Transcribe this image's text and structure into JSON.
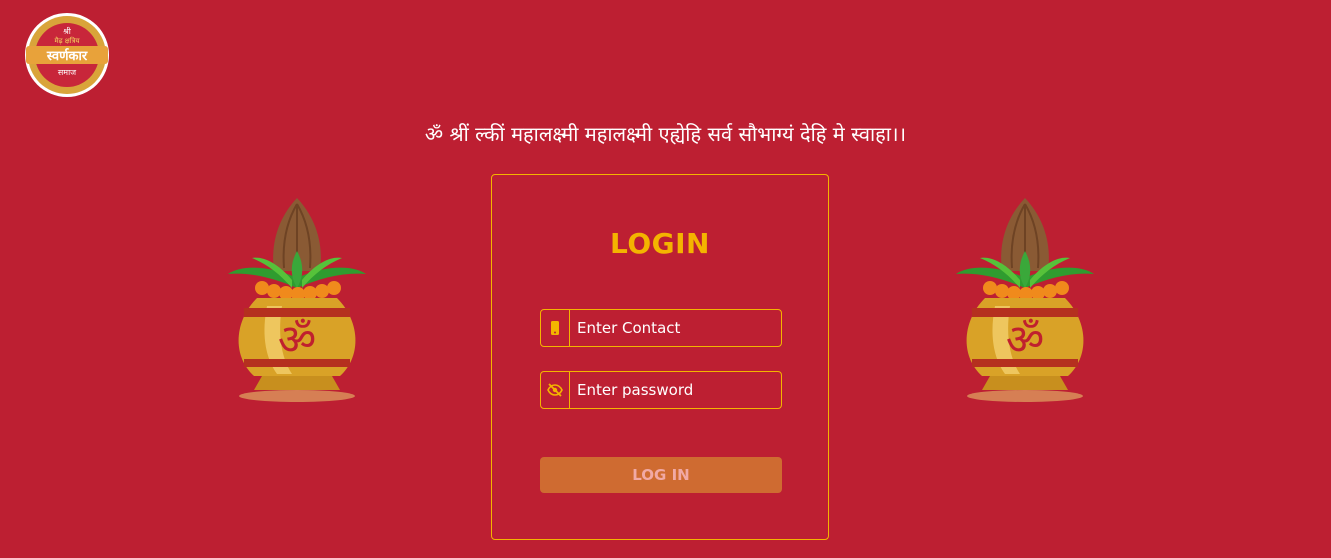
{
  "logo": {
    "top_text": "श्री",
    "sub_text": "मैढ़ क्षत्रिय",
    "main_text": "स्वर्णकार",
    "bottom_text": "समाज"
  },
  "mantra": "ॐ श्रीं ल्कीं महालक्ष्मी महालक्ष्मी एह्येहि सर्व सौभाग्यं देहि मे स्वाहा।।",
  "login": {
    "title": "LOGIN",
    "contact_placeholder": "Enter Contact",
    "password_placeholder": "Enter password",
    "button_label": "LOG IN"
  },
  "icons": {
    "contact": "phone-icon",
    "password": "eye-slash-icon"
  },
  "colors": {
    "background": "#bd1f32",
    "accent": "#f4b400",
    "button": "#cf6b31",
    "button_text": "#f1a9a5"
  }
}
